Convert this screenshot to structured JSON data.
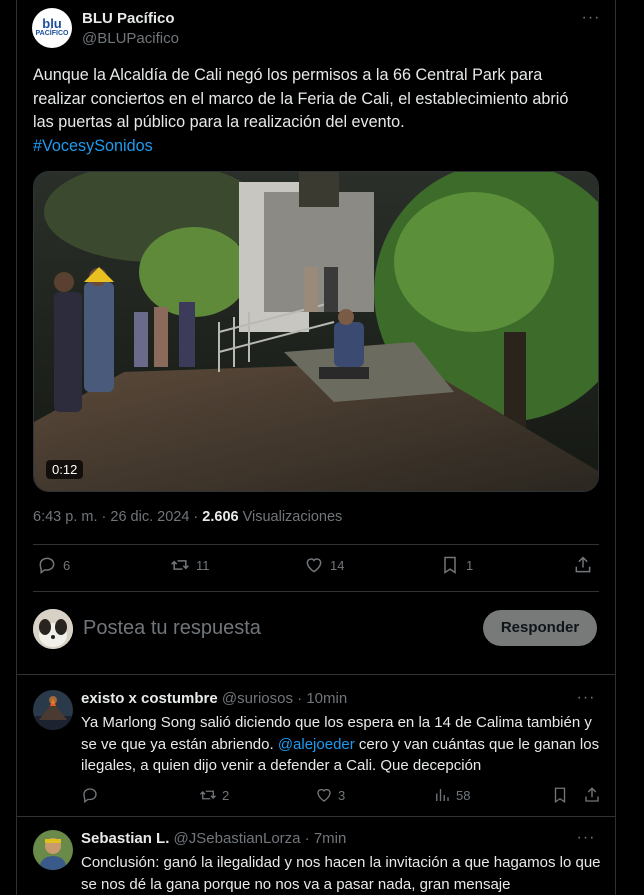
{
  "tweet": {
    "author_name": "BLU Pacífico",
    "author_handle": "@BLUPacifico",
    "avatar_logo_line1": "blu",
    "avatar_logo_line2": "PACÍFICO",
    "more_label": "···",
    "text": "Aunque la Alcaldía de Cali negó los permisos a la 66 Central Park para realizar conciertos en el marco de la Feria de Cali, el establecimiento abrió las puertas al público para la realización del evento.",
    "hashtag": "#VocesySonidos",
    "video_duration": "0:12",
    "time": "6:43 p. m.",
    "date": "26 dic. 2024",
    "views_count": "2.606",
    "views_label": "Visualizaciones",
    "replies": "6",
    "reposts": "11",
    "likes": "14",
    "bookmarks": "1"
  },
  "reply_composer": {
    "placeholder": "Postea tu respuesta",
    "button_label": "Responder"
  },
  "replies": [
    {
      "name": "existo x costumbre",
      "handle": "@suriosos",
      "time": "10min",
      "text_before": "Ya Marlong Song salió diciendo que los espera en la 14 de Calima también y se ve que ya están abriendo. ",
      "mention": "@alejoeder",
      "text_after": " cero y van cuántas que le ganan los ilegales, a quien dijo venir a defender a Cali. Que decepción",
      "reposts": "2",
      "likes": "3",
      "views": "58"
    },
    {
      "name": "Sebastian L.",
      "handle": "@JSebastianLorza",
      "time": "7min",
      "text": "Conclusión: ganó la ilegalidad y nos hacen la invitación a que hagamos lo que se nos dé la gana porque no nos va a pasar nada, gran mensaje"
    }
  ],
  "colors": {
    "background": "#000000",
    "text": "#e7e9ea",
    "muted": "#71767b",
    "accent": "#1d9bf0",
    "border": "#2f3336",
    "button": "#787a7a"
  }
}
